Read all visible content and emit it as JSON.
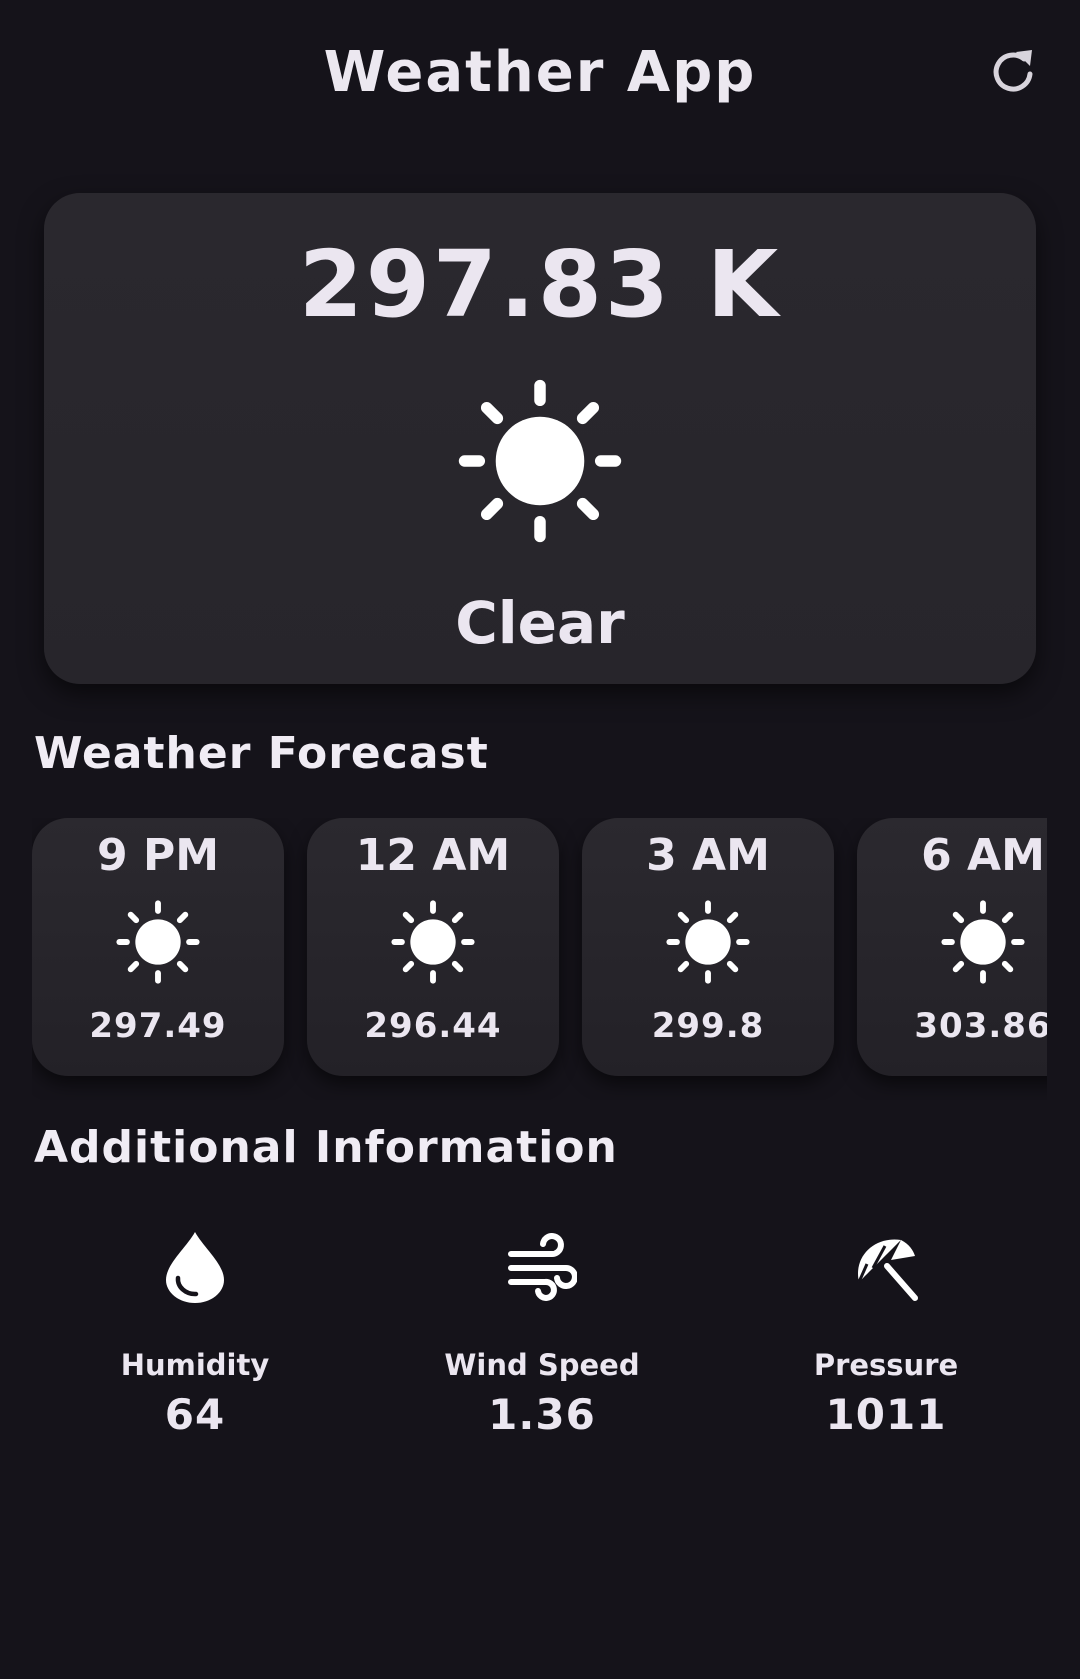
{
  "app": {
    "title": "Weather App"
  },
  "current": {
    "temperature": "297.83 K",
    "condition": "Clear",
    "icon": "sun-icon"
  },
  "forecast": {
    "title": "Weather Forecast",
    "items": [
      {
        "time": "9 PM",
        "temp": "297.49",
        "icon": "sun-icon"
      },
      {
        "time": "12 AM",
        "temp": "296.44",
        "icon": "sun-icon"
      },
      {
        "time": "3 AM",
        "temp": "299.8",
        "icon": "sun-icon"
      },
      {
        "time": "6 AM",
        "temp": "303.86",
        "icon": "sun-icon"
      }
    ]
  },
  "additional": {
    "title": "Additional Information",
    "items": [
      {
        "label": "Humidity",
        "value": "64",
        "icon": "water-drop-icon"
      },
      {
        "label": "Wind Speed",
        "value": "1.36",
        "icon": "wind-icon"
      },
      {
        "label": "Pressure",
        "value": "1011",
        "icon": "umbrella-icon"
      }
    ]
  },
  "colors": {
    "background": "#15131a",
    "card": "#28262c",
    "text": "#ebe6f0"
  }
}
